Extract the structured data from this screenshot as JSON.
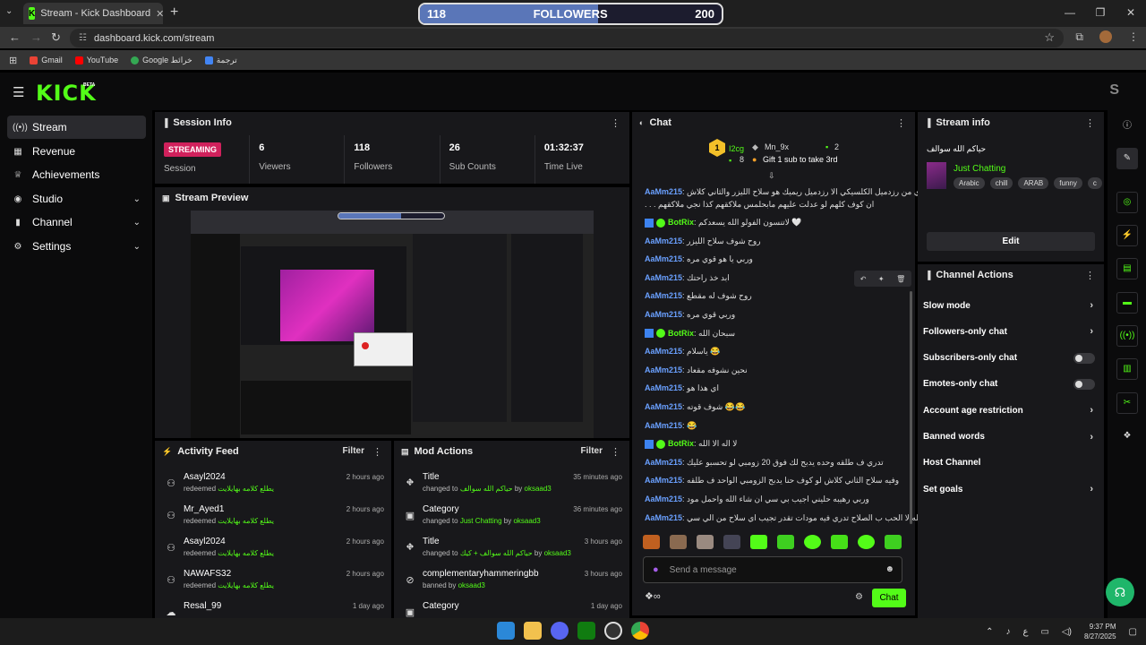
{
  "browser": {
    "tab_title": "Stream - Kick Dashboard",
    "url": "dashboard.kick.com/stream",
    "bookmarks": [
      "Gmail",
      "YouTube",
      "Google خرائط",
      "ترجمة"
    ]
  },
  "follow_widget": {
    "current": "118",
    "label": "FOLLOWERS",
    "goal": "200",
    "progress": 0.59
  },
  "kick": {
    "logo": "KICK",
    "beta": "BETA",
    "user_initial": "S"
  },
  "sidebar": {
    "items": [
      {
        "label": "Stream",
        "icon": "stream-icon"
      },
      {
        "label": "Revenue",
        "icon": "revenue-icon"
      },
      {
        "label": "Achievements",
        "icon": "trophy-icon"
      },
      {
        "label": "Studio",
        "icon": "studio-icon"
      },
      {
        "label": "Channel",
        "icon": "channel-icon"
      },
      {
        "label": "Settings",
        "icon": "gear-icon"
      }
    ]
  },
  "session": {
    "title": "Session Info",
    "status": "STREAMING",
    "status_label": "Session",
    "viewers": "6",
    "viewers_label": "Viewers",
    "followers": "118",
    "followers_label": "Followers",
    "subs": "26",
    "subs_label": "Sub Counts",
    "time": "01:32:37",
    "time_label": "Time Live"
  },
  "preview": {
    "title": "Stream Preview"
  },
  "activity": {
    "title": "Activity Feed",
    "filter": "Filter",
    "items": [
      {
        "name": "Asayl2024",
        "action": "redeemed",
        "reward": "يطلع كلامه بهايلايت",
        "time": "2 hours ago"
      },
      {
        "name": "Mr_Ayed1",
        "action": "redeemed",
        "reward": "يطلع كلامه بهايلايت",
        "time": "2 hours ago"
      },
      {
        "name": "Asayl2024",
        "action": "redeemed",
        "reward": "يطلع كلامه بهايلايت",
        "time": "2 hours ago"
      },
      {
        "name": "NAWAFS32",
        "action": "redeemed",
        "reward": "يطلع كلامه بهايلايت",
        "time": "2 hours ago"
      },
      {
        "name": "Resal_99",
        "action": "",
        "reward": "",
        "time": "1 day ago"
      }
    ]
  },
  "mod": {
    "title": "Mod Actions",
    "filter": "Filter",
    "items": [
      {
        "name": "Title",
        "pre": "changed to",
        "val": "حياكم الله سوالف",
        "by": "by",
        "mod": "oksaad3",
        "time": "35 minutes ago"
      },
      {
        "name": "Category",
        "pre": "changed to",
        "val": "Just Chatting",
        "by": "by",
        "mod": "oksaad3",
        "time": "36 minutes ago"
      },
      {
        "name": "Title",
        "pre": "changed to",
        "val": "حياكم الله سوالف + كيك",
        "by": "by",
        "mod": "oksaad3",
        "time": "3 hours ago"
      },
      {
        "name": "complementaryhammeringbb",
        "pre": "banned by",
        "val": "",
        "by": "",
        "mod": "oksaad3",
        "time": "3 hours ago"
      },
      {
        "name": "Category",
        "pre": "",
        "val": "",
        "by": "",
        "mod": "",
        "time": "1 day ago"
      }
    ]
  },
  "chat": {
    "title": "Chat",
    "top_gifter": "I2cg",
    "top_gifter_count": "8",
    "top_gifter_rank": "1",
    "second": "Mn_9x",
    "second_count": "2",
    "gift_prompt": "Gift 1 sub to take 3rd",
    "messages": [
      {
        "user": "AaMm215",
        "text": "تدري من رزدميل الكلسيكي الا رزدميل ريميك هو سلاح الليزر والثاني كلاش",
        "text2": ". . . ان كوف كلهم لو عدلت عليهم مابحلمس ملاكقهم كذا نجي ملاكقهم",
        "bot": false
      },
      {
        "user": "BotRix",
        "text": "لاتنسون الفولو الله يسعدكم 🤍",
        "bot": true
      },
      {
        "user": "AaMm215",
        "text": "روح شوف سلاح الليزر",
        "bot": false
      },
      {
        "user": "AaMm215",
        "text": "وربي يا هو قوي مره",
        "bot": false
      },
      {
        "user": "AaMm215",
        "text": "ابد خذ راحتك",
        "bot": false
      },
      {
        "user": "AaMm215",
        "text": "روح شوف له مقطع",
        "bot": false
      },
      {
        "user": "AaMm215",
        "text": "وربي قوي مره",
        "bot": false
      },
      {
        "user": "BotRix",
        "text": "سبحان الله",
        "bot": true
      },
      {
        "user": "AaMm215",
        "text": "ياسلام 😂",
        "bot": false
      },
      {
        "user": "AaMm215",
        "text": "نحين نشوفه مقعاد",
        "bot": false
      },
      {
        "user": "AaMm215",
        "text": "اي هذا هو",
        "bot": false
      },
      {
        "user": "AaMm215",
        "text": "شوف قوته 😂😂",
        "bot": false
      },
      {
        "user": "AaMm215",
        "text": "😂",
        "bot": false
      },
      {
        "user": "BotRix",
        "text": "لا اله الا الله",
        "bot": true
      },
      {
        "user": "AaMm215",
        "text": "تدري ف طلقه وحده يدبح لك فوق 20 زومبي لو تحسبو عليك",
        "bot": false
      },
      {
        "user": "AaMm215",
        "text": "وفيه سلاح الثاني كلاش لو كوف حنا يدبح الزومبي الواحد ف طلقه",
        "bot": false
      },
      {
        "user": "AaMm215",
        "text": "وربي رهيبه حليني اجيب بي سي ان شاء الله واحمل مود",
        "bot": false
      },
      {
        "user": "AaMm215",
        "text": "والله لا الحب ب الصلاح تدري فيه مودات تقدر تجيب اي سلاح من الي سي",
        "bot": false
      }
    ],
    "input_placeholder": "Send a message",
    "send_label": "Chat"
  },
  "stream_info": {
    "title": "Stream info",
    "stream_title": "حياكم الله سوالف",
    "category": "Just Chatting",
    "tags": [
      "Arabic",
      "chill",
      "ARAB",
      "funny",
      "c"
    ],
    "edit": "Edit"
  },
  "channel_actions": {
    "title": "Channel Actions",
    "items": [
      {
        "label": "Slow mode",
        "kind": "chevron"
      },
      {
        "label": "Followers-only chat",
        "kind": "chevron"
      },
      {
        "label": "Subscribers-only chat",
        "kind": "toggle"
      },
      {
        "label": "Emotes-only chat",
        "kind": "toggle"
      },
      {
        "label": "Account age restriction",
        "kind": "chevron"
      },
      {
        "label": "Banned words",
        "kind": "chevron"
      },
      {
        "label": "Host Channel",
        "kind": "none"
      },
      {
        "label": "Set goals",
        "kind": "chevron"
      }
    ]
  },
  "taskbar": {
    "lang": "ع",
    "time": "9:37 PM",
    "date": "8/27/2025"
  },
  "colors": {
    "accent": "#53fc18",
    "panel": "#18181b",
    "username": "#6aa0ff",
    "streaming": "#d0215c"
  }
}
